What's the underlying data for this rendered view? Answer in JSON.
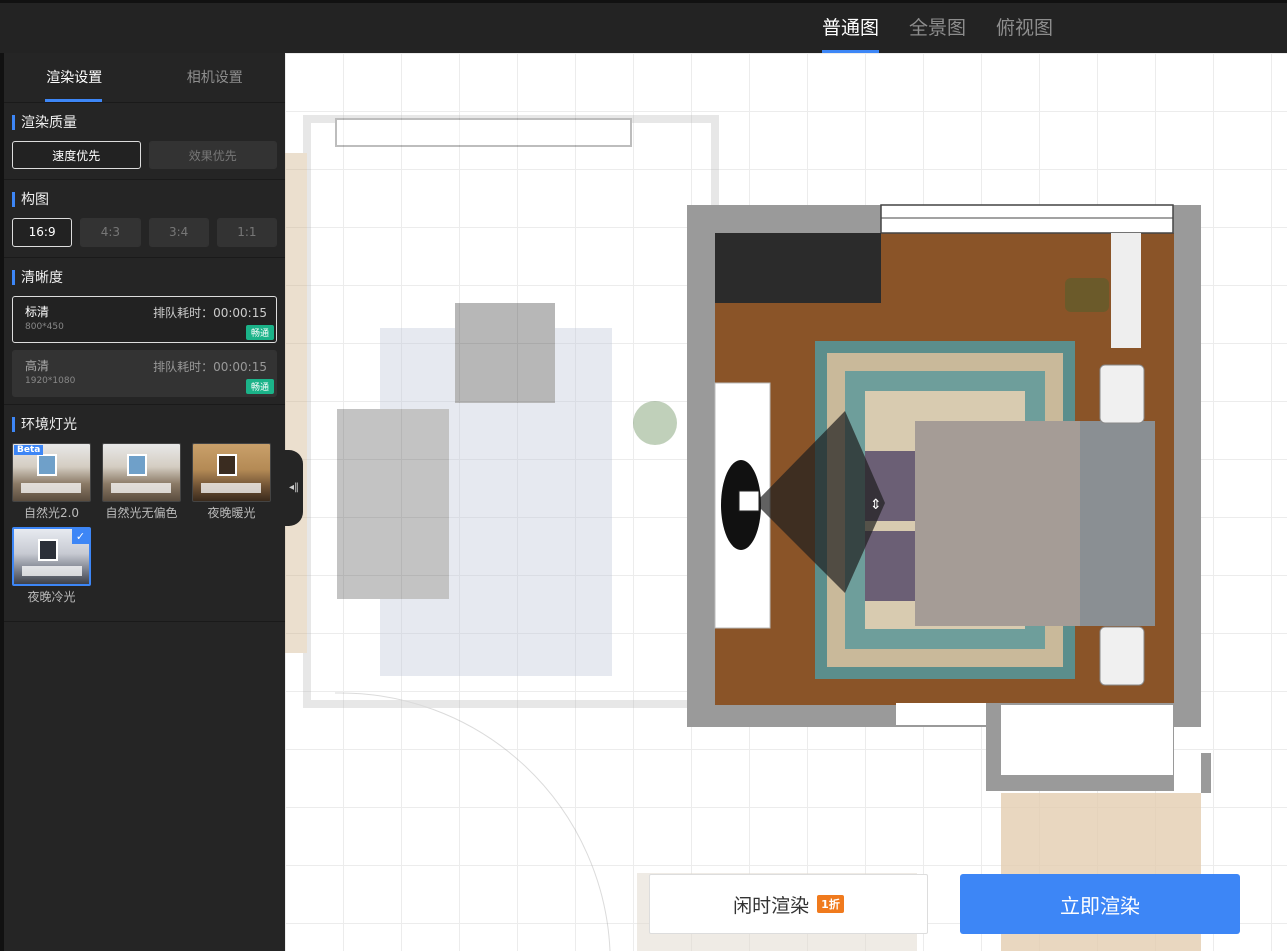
{
  "top_tabs": [
    {
      "label": "普通图",
      "active": true
    },
    {
      "label": "全景图",
      "active": false
    },
    {
      "label": "俯视图",
      "active": false
    }
  ],
  "sidebar": {
    "tabs": [
      {
        "label": "渲染设置",
        "active": true
      },
      {
        "label": "相机设置",
        "active": false
      }
    ],
    "quality": {
      "title": "渲染质量",
      "options": [
        {
          "label": "速度优先",
          "active": true
        },
        {
          "label": "效果优先",
          "active": false
        }
      ]
    },
    "composition": {
      "title": "构图",
      "options": [
        {
          "label": "16:9",
          "active": true
        },
        {
          "label": "4:3",
          "active": false
        },
        {
          "label": "3:4",
          "active": false
        },
        {
          "label": "1:1",
          "active": false
        }
      ]
    },
    "resolution": {
      "title": "清晰度",
      "options": [
        {
          "name": "标清",
          "size": "800*450",
          "wait": "排队耗时：00:00:15",
          "badge": "畅通",
          "active": true
        },
        {
          "name": "高清",
          "size": "1920*1080",
          "wait": "排队耗时：00:00:15",
          "badge": "畅通",
          "active": false
        }
      ]
    },
    "lighting": {
      "title": "环境灯光",
      "options": [
        {
          "label": "自然光2.0",
          "beta": "Beta",
          "style": "day",
          "selected": false
        },
        {
          "label": "自然光无偏色",
          "style": "day",
          "selected": false
        },
        {
          "label": "夜晚暖光",
          "style": "warm",
          "selected": true
        },
        {
          "label": "夜晚冷光",
          "style": "cool",
          "selected": true
        }
      ]
    }
  },
  "actions": {
    "idle_render": "闲时渲染",
    "idle_badge": "1折",
    "render_now": "立即渲染"
  },
  "colors": {
    "accent": "#3d86f6",
    "badge_green": "#1bb389",
    "badge_orange": "#f07a1d",
    "floor_wood": "#8a5428",
    "wall_gray": "#9a9a9a"
  },
  "icons": {
    "collapse": "collapse-arrow-icon",
    "check": "check-icon",
    "camera": "camera-icon"
  }
}
